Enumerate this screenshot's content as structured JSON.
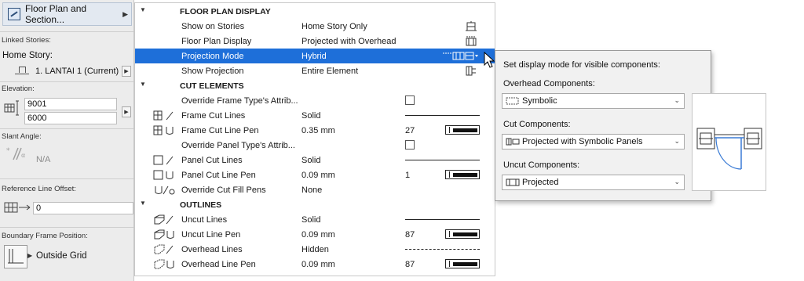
{
  "left_panel": {
    "header_label": "Floor Plan and Section...",
    "linked_stories_label": "Linked Stories:",
    "home_story_label": "Home Story:",
    "home_story_value": "1. LANTAI 1 (Current)",
    "elevation_label": "Elevation:",
    "elevation_top": "9001",
    "elevation_bottom": "6000",
    "slant_angle_label": "Slant Angle:",
    "slant_angle_value": "N/A",
    "ref_line_offset_label": "Reference Line Offset:",
    "ref_line_offset_value": "0",
    "boundary_frame_label": "Boundary Frame Position:",
    "boundary_frame_value": "Outside Grid"
  },
  "table": {
    "sections": {
      "floor_plan_display": "FLOOR PLAN DISPLAY",
      "cut_elements": "CUT ELEMENTS",
      "outlines": "OUTLINES"
    },
    "rows": {
      "show_on_stories": {
        "name": "Show on Stories",
        "value": "Home Story Only"
      },
      "floor_plan_display": {
        "name": "Floor Plan Display",
        "value": "Projected with Overhead"
      },
      "projection_mode": {
        "name": "Projection Mode",
        "value": "Hybrid"
      },
      "show_projection": {
        "name": "Show Projection",
        "value": "Entire Element"
      },
      "override_frame": {
        "name": "Override Frame Type's Attrib..."
      },
      "frame_cut_lines": {
        "name": "Frame Cut Lines",
        "value": "Solid"
      },
      "frame_cut_line_pen": {
        "name": "Frame Cut Line Pen",
        "value": "0.35 mm",
        "num": "27"
      },
      "override_panel": {
        "name": "Override Panel Type's Attrib..."
      },
      "panel_cut_lines": {
        "name": "Panel Cut Lines",
        "value": "Solid"
      },
      "panel_cut_line_pen": {
        "name": "Panel Cut Line Pen",
        "value": "0.09 mm",
        "num": "1"
      },
      "override_cut_fill": {
        "name": "Override Cut Fill Pens",
        "value": "None"
      },
      "uncut_lines": {
        "name": "Uncut Lines",
        "value": "Solid"
      },
      "uncut_line_pen": {
        "name": "Uncut Line Pen",
        "value": "0.09 mm",
        "num": "87"
      },
      "overhead_lines": {
        "name": "Overhead Lines",
        "value": "Hidden"
      },
      "overhead_line_pen": {
        "name": "Overhead Line Pen",
        "value": "0.09 mm",
        "num": "87"
      }
    }
  },
  "popup": {
    "title": "Set display mode for visible components:",
    "overhead_label": "Overhead Components:",
    "overhead_value": "Symbolic",
    "cut_label": "Cut Components:",
    "cut_value": "Projected with Symbolic Panels",
    "uncut_label": "Uncut Components:",
    "uncut_value": "Projected"
  },
  "colors": {
    "selection": "#1e6fd9",
    "panel_bg": "#ececec",
    "popup_bg": "#f1f1f1"
  }
}
